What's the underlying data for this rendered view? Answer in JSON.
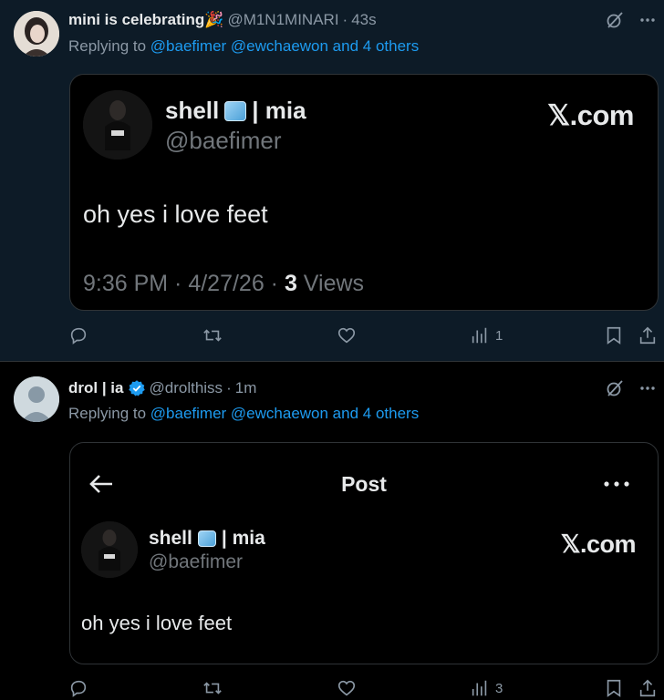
{
  "tweets": [
    {
      "display_name": "mini is celebrating🎉",
      "handle": "@M1N1MINARI",
      "time": "43s",
      "replying_prefix": "Replying to",
      "replying_mentions": "@baefimer @ewchaewon and 4 others",
      "embed": {
        "name": "shell",
        "name_suffix": "| mia",
        "handle": "@baefimer",
        "brand": "𝕏.com",
        "text": "oh yes i love feet",
        "time": "9:36 PM · 4/27/26 · ",
        "views_count": "3",
        "views_label": " Views"
      },
      "actions": {
        "views": "1"
      }
    },
    {
      "display_name": "drol | ia",
      "handle": "@drolthiss",
      "time": "1m",
      "replying_prefix": "Replying to",
      "replying_mentions": "@baefimer @ewchaewon and 4 others",
      "embed": {
        "header_title": "Post",
        "name": "shell",
        "name_suffix": "| mia",
        "handle": "@baefimer",
        "brand": "𝕏.com",
        "text": "oh yes i love feet"
      },
      "actions": {
        "views": "3"
      }
    }
  ],
  "colors": {
    "accent": "#1d9bf0",
    "muted": "#8b98a5",
    "highlight_bg": "#0d1b27"
  },
  "icons": [
    "grok-icon",
    "more-icon",
    "reply-icon",
    "retweet-icon",
    "like-icon",
    "views-icon",
    "bookmark-icon",
    "share-icon",
    "back-arrow-icon",
    "verified-icon"
  ]
}
